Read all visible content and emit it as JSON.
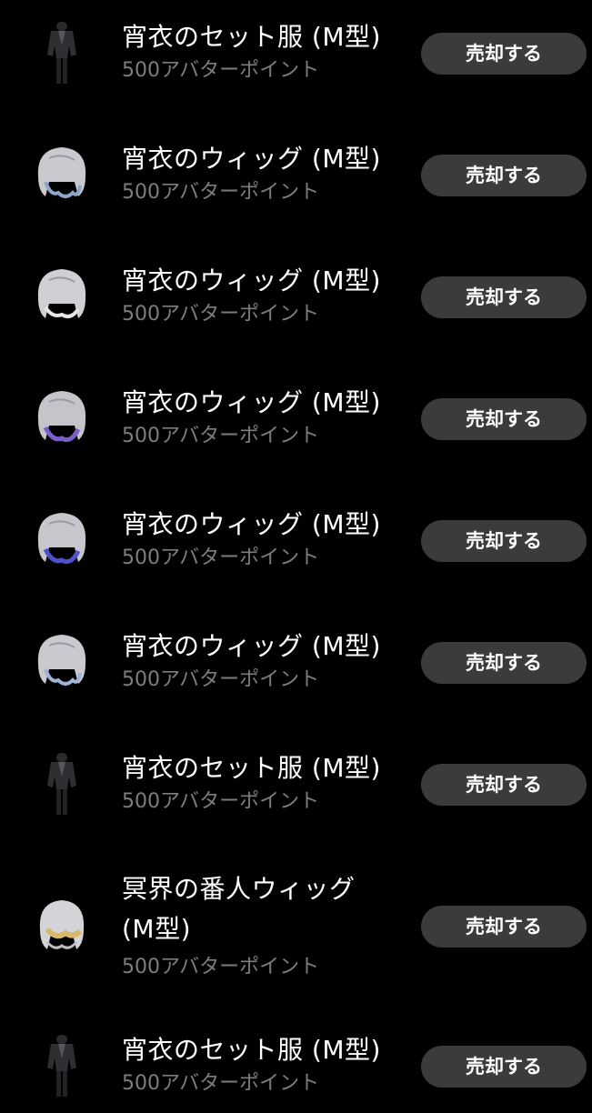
{
  "colors": {
    "background": "#000000",
    "button_bg": "#3b3b3b",
    "price_text": "#7d7d7d"
  },
  "items": [
    {
      "name": "宵衣のセット服 (M型)",
      "price": "500アバターポイント",
      "button": "売却する",
      "icon": "outfit-icon"
    },
    {
      "name": "宵衣のウィッグ (M型)",
      "price": "500アバターポイント",
      "button": "売却する",
      "icon": "wig-icon"
    },
    {
      "name": "宵衣のウィッグ (M型)",
      "price": "500アバターポイント",
      "button": "売却する",
      "icon": "wig-icon"
    },
    {
      "name": "宵衣のウィッグ (M型)",
      "price": "500アバターポイント",
      "button": "売却する",
      "icon": "wig-icon"
    },
    {
      "name": "宵衣のウィッグ (M型)",
      "price": "500アバターポイント",
      "button": "売却する",
      "icon": "wig-icon"
    },
    {
      "name": "宵衣のウィッグ (M型)",
      "price": "500アバターポイント",
      "button": "売却する",
      "icon": "wig-icon"
    },
    {
      "name": "宵衣のセット服 (M型)",
      "price": "500アバターポイント",
      "button": "売却する",
      "icon": "outfit-icon"
    },
    {
      "name": "冥界の番人ウィッグ (M型)",
      "price": "500アバターポイント",
      "button": "売却する",
      "icon": "wig-icon"
    },
    {
      "name": "宵衣のセット服 (M型)",
      "price": "500アバターポイント",
      "button": "売却する",
      "icon": "outfit-icon"
    }
  ]
}
